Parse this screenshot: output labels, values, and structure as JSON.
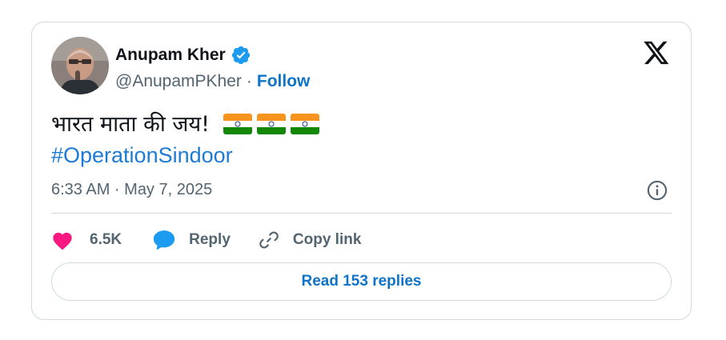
{
  "author": {
    "name": "Anupam Kher",
    "handle": "@AnupamPKher",
    "separator": "·",
    "follow_label": "Follow",
    "verified_icon": "verified-badge-icon",
    "verified_color": "#1d9bf0"
  },
  "tweet": {
    "text": "भारत माता की जय!",
    "emoji_flags": [
      "india-flag-icon",
      "india-flag-icon",
      "india-flag-icon"
    ],
    "hashtag": "#OperationSindoor",
    "timestamp": "6:33 AM · May 7, 2025"
  },
  "actions": {
    "like_count": "6.5K",
    "reply_label": "Reply",
    "copy_link_label": "Copy link"
  },
  "footer": {
    "read_replies_label": "Read 153 replies"
  },
  "icons": {
    "platform_logo": "x-logo-icon",
    "info": "info-icon",
    "heart": "heart-icon",
    "reply": "speech-bubble-icon",
    "link": "link-icon"
  },
  "colors": {
    "accent": "#0f74c7",
    "hashtag": "#1d7bd3",
    "like": "#f91880",
    "reply_bubble": "#1d9bf0",
    "muted_text": "#536471",
    "border": "#cfd9de"
  }
}
